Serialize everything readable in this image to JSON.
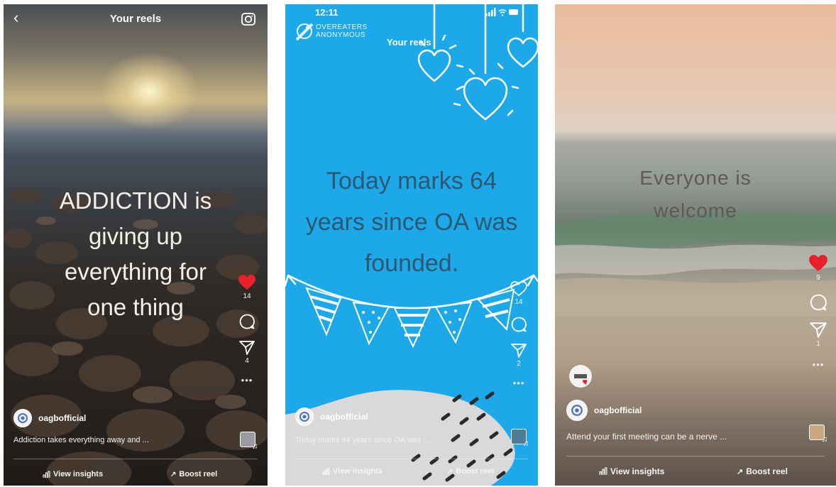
{
  "reels": [
    {
      "title": "Your reels",
      "overlay_text": "ADDICTION is\ngiving up\neverything for\none thing",
      "likes": "14",
      "shares": "4",
      "username": "oagbofficial",
      "caption": "Addiction takes everything away and ...",
      "view_insights": "View insights",
      "boost_reel": "Boost reel"
    },
    {
      "time": "12:11",
      "logo_line1": "OVEREATERS",
      "logo_line2": "ANONYMOUS",
      "title": "Your reels",
      "overlay_text": "Today marks 64\nyears since OA was\nfounded.",
      "likes": "14",
      "shares": "2",
      "username": "oagbofficial",
      "caption": "Today marks 64 years since OA was ...",
      "view_insights": "View insights",
      "boost_reel": "Boost reel"
    },
    {
      "overlay_text": "Everyone is\nwelcome",
      "likes": "9",
      "shares": "1",
      "username": "oagbofficial",
      "caption": "Attend your first meeting can be a nerve ...",
      "view_insights": "View insights",
      "boost_reel": "Boost reel"
    }
  ],
  "colors": {
    "like_red": "#e8202a",
    "panel2_blue": "#1ca8e9",
    "overlay2_text": "#2c5870"
  },
  "icons": [
    "back-icon",
    "camera-icon",
    "heart-icon",
    "comment-icon",
    "send-icon",
    "more-icon",
    "reel-audio-icon",
    "insights-icon",
    "boost-icon",
    "overeaters-anonymous-logo"
  ]
}
